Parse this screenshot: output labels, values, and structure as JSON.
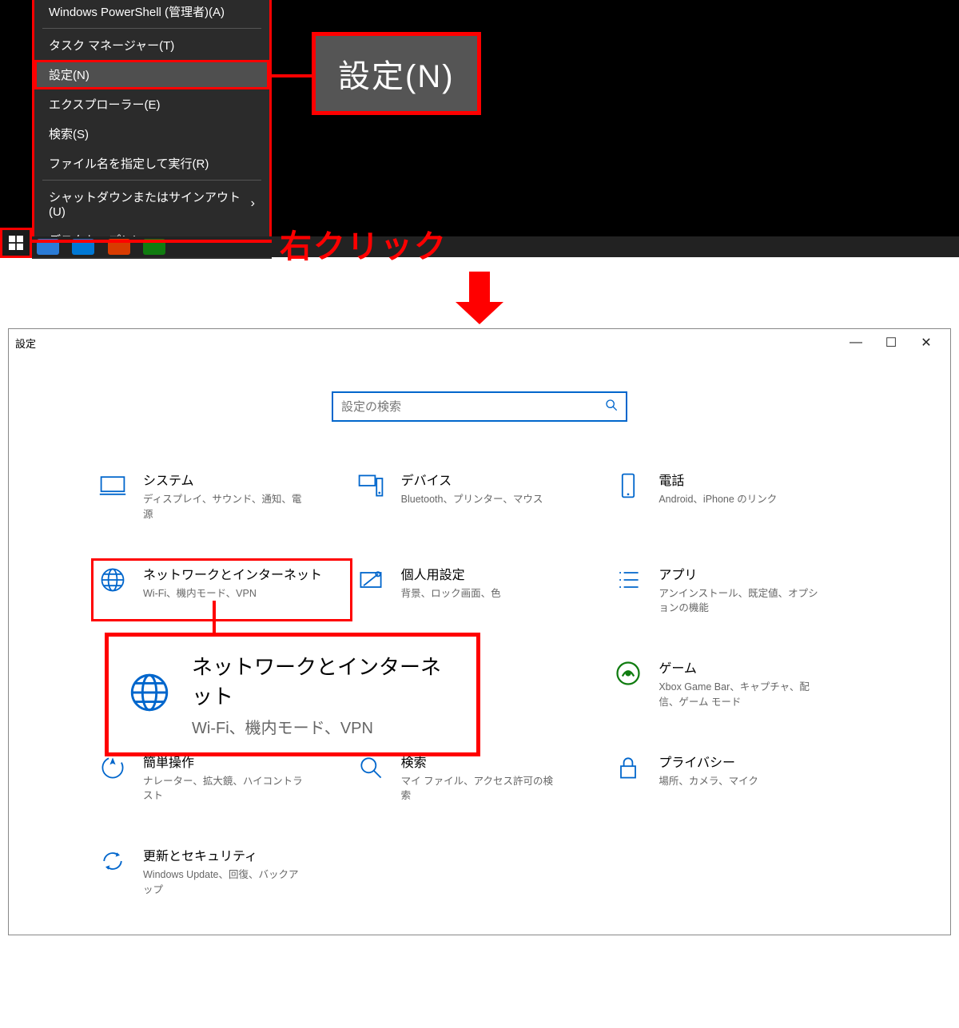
{
  "annotations": {
    "right_click_label": "右クリック",
    "settings_callout": "設定(N)"
  },
  "context_menu": {
    "items": [
      {
        "label": "Windows PowerShell (管理者)(A)"
      },
      {
        "label": "タスク マネージャー(T)"
      },
      {
        "label": "設定(N)"
      },
      {
        "label": "エクスプローラー(E)"
      },
      {
        "label": "検索(S)"
      },
      {
        "label": "ファイル名を指定して実行(R)"
      },
      {
        "label": "シャットダウンまたはサインアウト(U)",
        "has_submenu": true
      },
      {
        "label": "デスクトップ(D)"
      }
    ]
  },
  "settings_window": {
    "title": "設定",
    "search_placeholder": "設定の検索",
    "categories": [
      {
        "title": "システム",
        "subtitle": "ディスプレイ、サウンド、通知、電源",
        "icon": "system"
      },
      {
        "title": "デバイス",
        "subtitle": "Bluetooth、プリンター、マウス",
        "icon": "devices"
      },
      {
        "title": "電話",
        "subtitle": "Android、iPhone のリンク",
        "icon": "phone"
      },
      {
        "title": "ネットワークとインターネット",
        "subtitle": "Wi-Fi、機内モード、VPN",
        "icon": "network"
      },
      {
        "title": "個人用設定",
        "subtitle": "背景、ロック画面、色",
        "icon": "personalization"
      },
      {
        "title": "アプリ",
        "subtitle": "アンインストール、既定値、オプションの機能",
        "icon": "apps"
      },
      {
        "title": "",
        "subtitle": "",
        "icon": "blank"
      },
      {
        "title": "ゲーム",
        "subtitle": "Xbox Game Bar、キャプチャ、配信、ゲーム モード",
        "icon": "gaming"
      },
      {
        "title": "簡単操作",
        "subtitle": "ナレーター、拡大鏡、ハイコントラスト",
        "icon": "ease"
      },
      {
        "title": "検索",
        "subtitle": "マイ ファイル、アクセス許可の検索",
        "icon": "search"
      },
      {
        "title": "プライバシー",
        "subtitle": "場所、カメラ、マイク",
        "icon": "privacy"
      },
      {
        "title": "更新とセキュリティ",
        "subtitle": "Windows Update、回復、バックアップ",
        "icon": "update"
      }
    ]
  },
  "callout_network": {
    "title": "ネットワークとインターネット",
    "subtitle": "Wi-Fi、機内モード、VPN"
  }
}
